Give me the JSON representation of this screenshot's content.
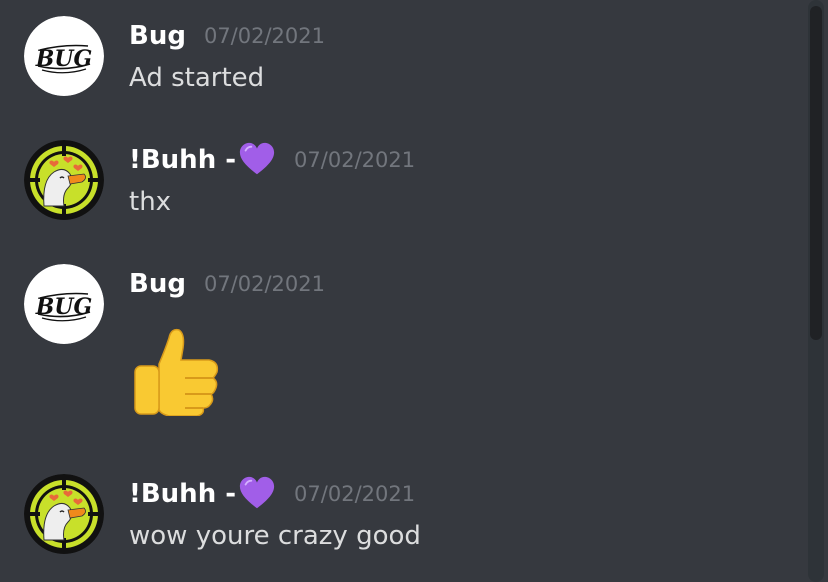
{
  "messages": [
    {
      "username": "Bug",
      "timestamp": "07/02/2021",
      "text": "Ad started",
      "avatar_icon": "bug-logo-avatar"
    },
    {
      "username": "!Buhh -",
      "username_emoji": "purple-heart-icon",
      "timestamp": "07/02/2021",
      "text": "thx",
      "avatar_icon": "duck-target-avatar"
    },
    {
      "username": "Bug",
      "timestamp": "07/02/2021",
      "emoji": "thumbs-up-icon",
      "avatar_icon": "bug-logo-avatar"
    },
    {
      "username": "!Buhh -",
      "username_emoji": "purple-heart-icon",
      "timestamp": "07/02/2021",
      "text": "wow youre crazy good",
      "avatar_icon": "duck-target-avatar"
    }
  ],
  "avatar_logo_text": "BUG",
  "colors": {
    "background": "#36393f",
    "username": "#ffffff",
    "message_text": "#dcddde",
    "timestamp": "#72767d",
    "heart": "#a15ee8",
    "duck_ring": "#c8e02a"
  }
}
